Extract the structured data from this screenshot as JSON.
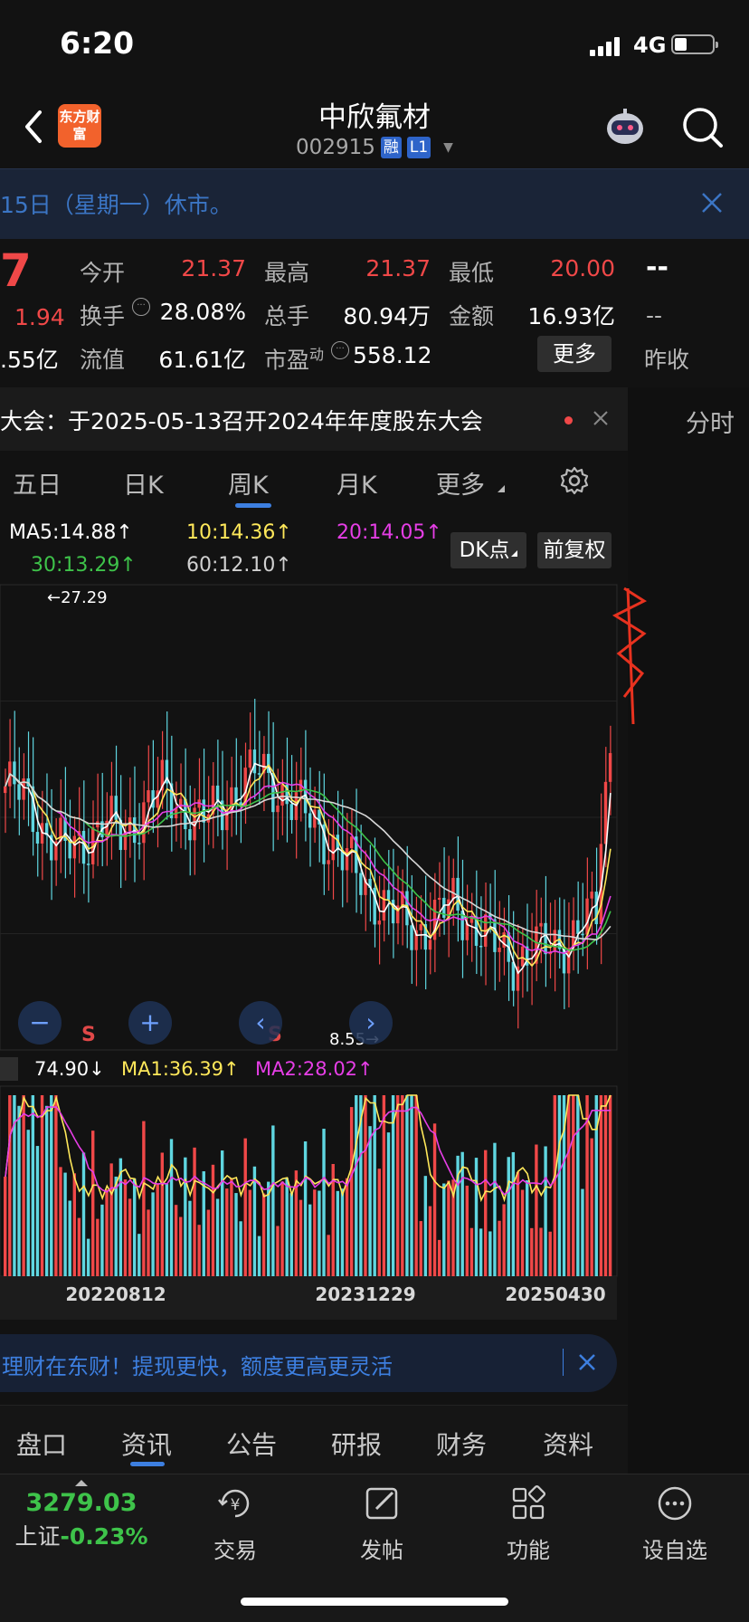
{
  "status_bar": {
    "time": "6:20",
    "network": "4G"
  },
  "header": {
    "logo_text": "东方财富",
    "stock_name": "中欣氟材",
    "stock_code": "002915",
    "tag_margin": "融",
    "tag_level": "L1"
  },
  "notice": {
    "text": "15日（星期一）休市。"
  },
  "quote": {
    "price_partial": "7",
    "change_partial": "1.94",
    "cap_partial": ".55亿",
    "open_label": "今开",
    "open_value": "21.37",
    "high_label": "最高",
    "high_value": "21.37",
    "low_label": "最低",
    "low_value": "20.00",
    "turnover_label": "换手",
    "turnover_value": "28.08%",
    "volume_label": "总手",
    "volume_value": "80.94万",
    "amount_label": "金额",
    "amount_value": "16.93亿",
    "float_label": "流值",
    "float_value": "61.61亿",
    "pe_label": "市盈",
    "pe_sup": "动",
    "pe_value": "558.12",
    "more_button": "更多",
    "right_top": "--",
    "right_mid": "--",
    "prev_close_label": "昨收"
  },
  "announcement": {
    "text": "大会：于2025-05-13召开2024年年度股东大会",
    "side_tab": "分时"
  },
  "period_tabs": [
    "五日",
    "日K",
    "周K",
    "月K",
    "更多"
  ],
  "active_period": "周K",
  "ma_legend": {
    "ma5": "MA5:14.88",
    "ma10": "10:14.36",
    "ma20": "20:14.05",
    "ma30": "30:13.29",
    "ma60": "60:12.10",
    "arrow_up": "↑"
  },
  "chips": {
    "dk": "DK点",
    "adjust": "前复权"
  },
  "chart_data": {
    "type": "candlestick",
    "period": "weekly",
    "price_high_marker": "27.29",
    "price_low_marker": "8.55",
    "signals": [
      "S",
      "S"
    ],
    "x_tick_labels": [
      "20220812",
      "20231229",
      "20250430"
    ],
    "volume_legend": {
      "vol": "74.90",
      "vol_arrow": "↓",
      "ma1": "MA1:36.39",
      "ma2": "MA2:28.02"
    },
    "ma_series_colors": {
      "MA5": "#ffffff",
      "MA10": "#ffe85a",
      "MA20": "#e63ee6",
      "MA30": "#3ec34a",
      "MA60": "#d8d8d8"
    },
    "colors": {
      "up": "#f04848",
      "down": "#5fd6e0"
    },
    "close_ma5": [
      19.4,
      18.9,
      17.4,
      16.4,
      16.9,
      17.8,
      17.1,
      18.3,
      19.2,
      18.5,
      17.8,
      18.4,
      19.5,
      20.1,
      19.3,
      18.4,
      17.6,
      16.5,
      15.4,
      14.4,
      13.5,
      12.9,
      13.4,
      14.1,
      13.2,
      12.2,
      11.6,
      11.9,
      12.2,
      12.6,
      13.4,
      14.0
    ]
  },
  "promo": {
    "text": "理财在东财！提现更快，额度更高更灵活"
  },
  "bottom_tabs": [
    "盘口",
    "资讯",
    "公告",
    "研报",
    "财务",
    "资料"
  ],
  "active_bottom_tab": "资讯",
  "bottom_nav": {
    "index_value": "3279.03",
    "index_name": "上证",
    "index_change": "-0.23%",
    "items": [
      "交易",
      "发帖",
      "功能",
      "设自选"
    ]
  }
}
